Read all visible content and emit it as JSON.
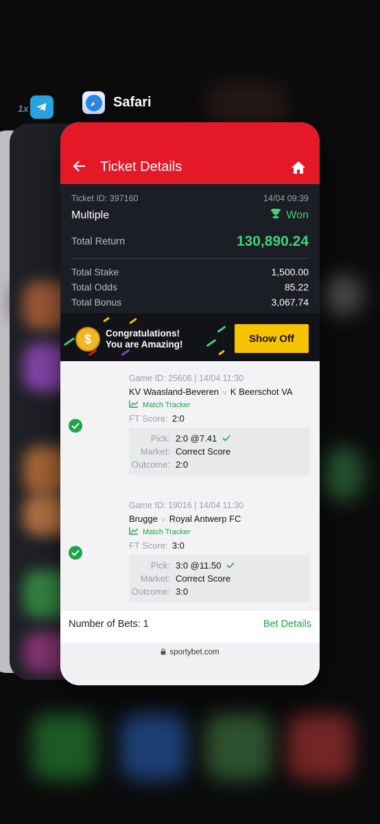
{
  "switcher": {
    "app_title": "Safari",
    "telegram_prefix": "1x"
  },
  "header": {
    "title": "Ticket Details"
  },
  "ticket": {
    "id_label": "Ticket ID: 397160",
    "date": "14/04 09:39",
    "type": "Multiple",
    "status": "Won",
    "total_return_label": "Total Return",
    "total_return": "130,890.24",
    "total_stake_label": "Total Stake",
    "total_stake": "1,500.00",
    "total_odds_label": "Total Odds",
    "total_odds": "85.22",
    "total_bonus_label": "Total Bonus",
    "total_bonus": "3,067.74"
  },
  "promo": {
    "line1": "Congratulations!",
    "line2": "You are Amazing!",
    "button": "Show Off"
  },
  "bets": [
    {
      "game_id": "Game ID: 25606 | 14/04 11:30",
      "home": "KV Waasland-Beveren",
      "vs": "v",
      "away": "K Beerschot VA",
      "tracker": "Match Tracker",
      "ft_label": "FT Score:",
      "ft_score": "2:0",
      "pick_label": "Pick:",
      "pick": "2:0 @7.41",
      "market_label": "Market:",
      "market": "Correct Score",
      "outcome_label": "Outcome:",
      "outcome": "2:0"
    },
    {
      "game_id": "Game ID: 19016 | 14/04 11:30",
      "home": "Brugge",
      "vs": "v",
      "away": "Royal Antwerp FC",
      "tracker": "Match Tracker",
      "ft_label": "FT Score:",
      "ft_score": "3:0",
      "pick_label": "Pick:",
      "pick": "3:0 @11.50",
      "market_label": "Market:",
      "market": "Correct Score",
      "outcome_label": "Outcome:",
      "outcome": "3:0"
    }
  ],
  "footer": {
    "number_of_bets": "Number of Bets: 1",
    "bet_details": "Bet Details"
  },
  "browser": {
    "url": "sportybet.com"
  },
  "colors": {
    "brand_red": "#e41827",
    "won_green": "#3fd27a",
    "accent_green": "#1ea545",
    "button_yellow": "#f7c300"
  }
}
